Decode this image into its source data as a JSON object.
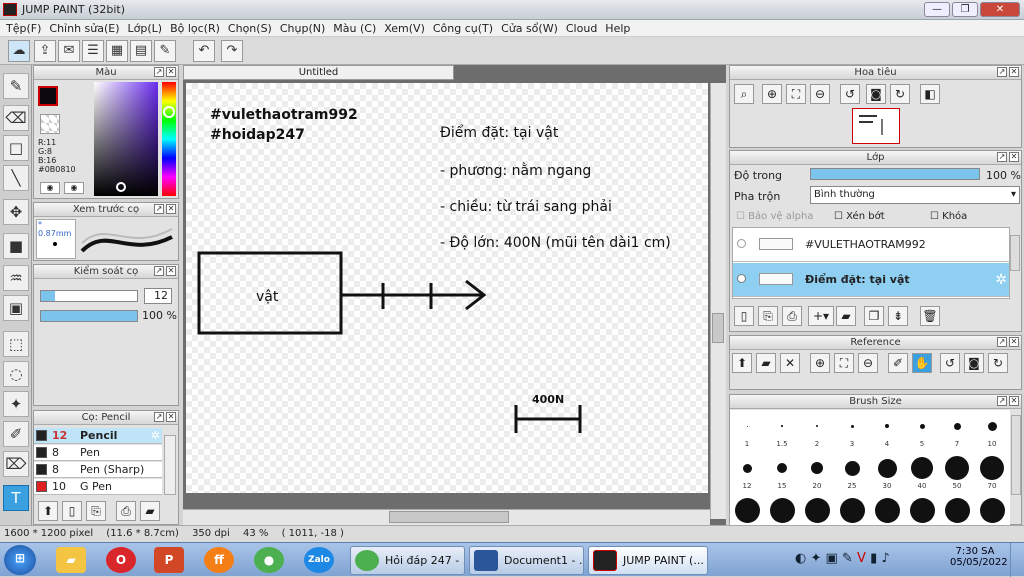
{
  "window": {
    "title": "JUMP PAINT (32bit)",
    "min": "—",
    "max": "❐",
    "close": "✕"
  },
  "menu": [
    "Tệp(F)",
    "Chỉnh sửa(E)",
    "Lớp(L)",
    "Bộ lọc(R)",
    "Chọn(S)",
    "Chụp(N)",
    "Màu (C)",
    "Xem(V)",
    "Công cụ(T)",
    "Cửa sổ(W)",
    "Cloud",
    "Help"
  ],
  "panels": {
    "color": {
      "title": "Màu",
      "r": "R:11",
      "g": "G:8",
      "b": "B:16",
      "hex": "#0B0810",
      "main_color": "#0B0810"
    },
    "preview": {
      "title": "Xem trước cọ",
      "size": "* 0.87mm"
    },
    "control": {
      "title": "Kiểm soát cọ",
      "size_value": "12",
      "opacity_value": "100 %",
      "size_fill": 0.15,
      "opacity_fill": 1.0
    },
    "brushes": {
      "title": "Cọ: Pencil",
      "items": [
        {
          "size": "12",
          "name": "Pencil",
          "color": "#222222"
        },
        {
          "size": "8",
          "name": "Pen",
          "color": "#222222"
        },
        {
          "size": "8",
          "name": "Pen (Sharp)",
          "color": "#222222"
        },
        {
          "size": "10",
          "name": "G Pen",
          "color": "#e02020"
        }
      ]
    },
    "navigator": {
      "title": "Hoa tiêu"
    },
    "layers": {
      "title": "Lớp",
      "opacity_label": "Độ trong",
      "opacity_value": "100 %",
      "opacity_fill": 1.0,
      "blend_label": "Pha trộn",
      "blend_value": "Bình thường",
      "protect_alpha": "Bảo vệ alpha",
      "clip": "Xén bớt",
      "lock": "Khóa",
      "items": [
        {
          "name": "#VULETHAOTRAM992",
          "selected": false
        },
        {
          "name": "Điểm đặt: tại vật",
          "selected": true
        }
      ]
    },
    "reference": {
      "title": "Reference"
    },
    "brush_size": {
      "title": "Brush Size",
      "row1": [
        "1",
        "1.5",
        "2",
        "3",
        "4",
        "5",
        "7",
        "10"
      ],
      "row2": [
        "12",
        "15",
        "20",
        "25",
        "30",
        "40",
        "50",
        "70"
      ]
    }
  },
  "document": {
    "tab": "Untitled",
    "texts": {
      "t1": "#vulethaotram992",
      "t2": "#hoidap247",
      "t3": "Điểm đặt: tại vật",
      "t4": "- phương: nằm ngang",
      "t5": "- chiều: từ trái sang phải",
      "t6": "- Độ lớn: 400N (mũi tên dài1 cm)",
      "box": "vật",
      "scale": "400N"
    }
  },
  "status": {
    "size": "1600 * 1200 pixel",
    "cm": "(11.6 * 8.7cm)",
    "dpi": "350 dpi",
    "zoom": "43 %",
    "coords": "( 1011, -18 )"
  },
  "taskbar": {
    "tasks": [
      {
        "label": "Hỏi đáp 247 - ..."
      },
      {
        "label": "Document1 - ..."
      },
      {
        "label": "JUMP PAINT (..."
      }
    ],
    "time": "7:30 SA",
    "date": "05/05/2022",
    "zalo": "Zalo"
  }
}
